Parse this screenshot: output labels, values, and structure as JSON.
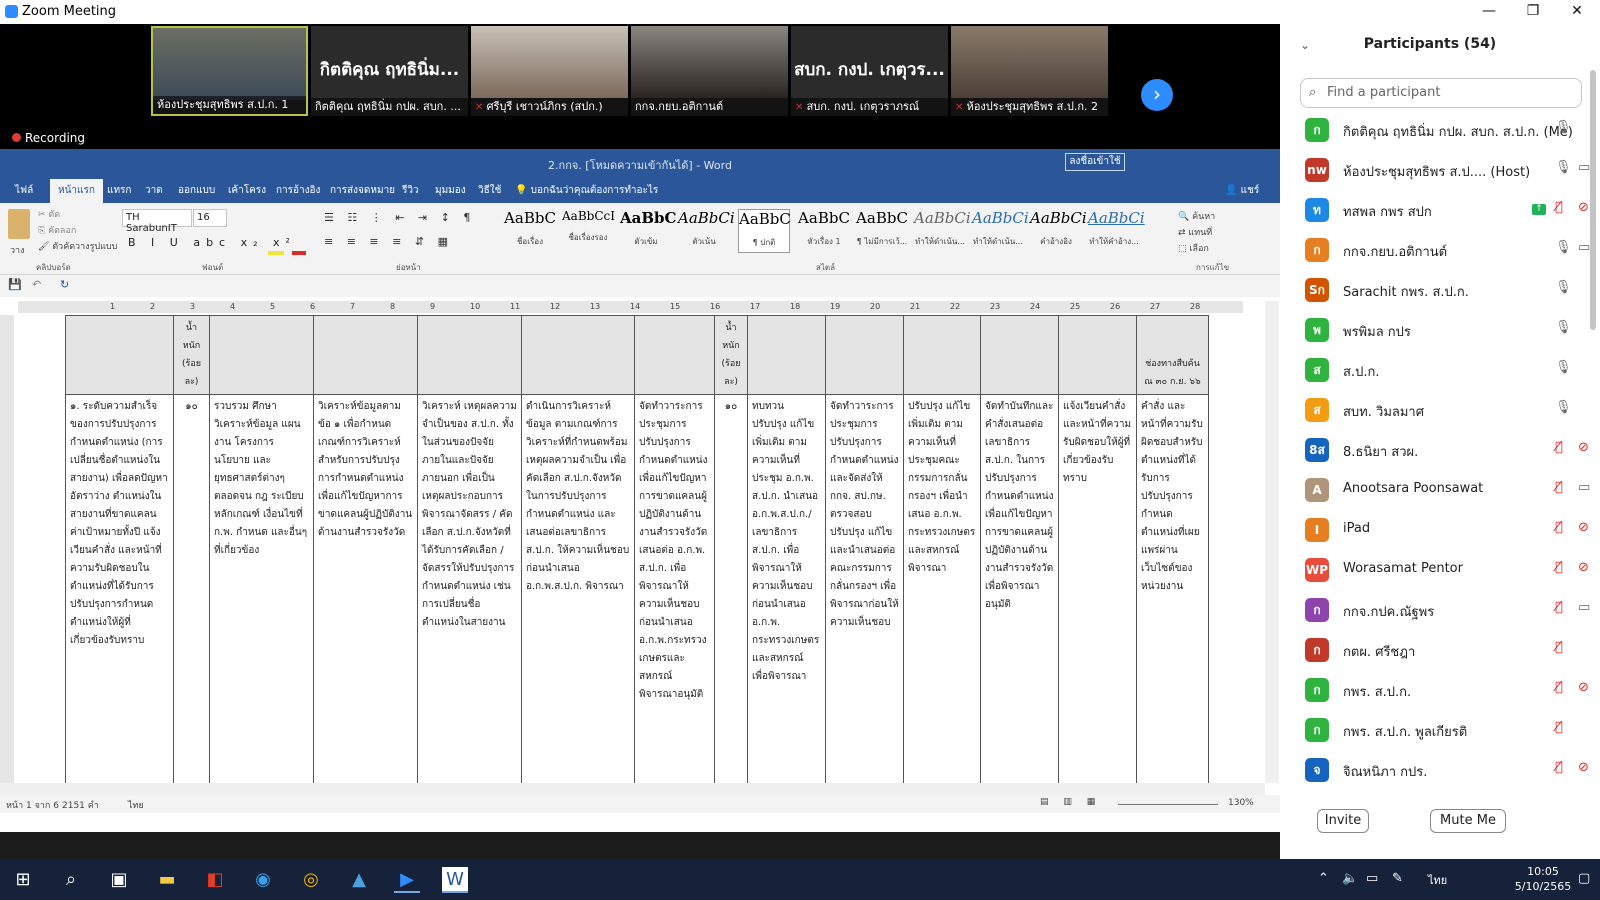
{
  "window": {
    "title": "Zoom Meeting",
    "min": "—",
    "max": "❐",
    "close": "✕"
  },
  "gallery": {
    "tiles": [
      {
        "caption": "ห้องประชุมสุทธิพร ส.ป.ก. 1",
        "big": ""
      },
      {
        "caption": "กิตติคุณ ฤทธินิ่ม กปผ. สบก. ...",
        "big": "กิตติคุณ ฤทธินิ่ม..."
      },
      {
        "caption": "ศรีบุรี เชาวน์ภิกร (สปก.)",
        "big": ""
      },
      {
        "caption": "กกจ.กยบ.อติกานต์",
        "big": ""
      },
      {
        "caption": "สบก. กงป. เกตุวราภรณ์",
        "big": "สบก. กงป. เกตุวร..."
      },
      {
        "caption": "ห้องประชุมสุทธิพร ส.ป.ก. 2",
        "big": ""
      }
    ],
    "next_icon": "›",
    "recording": "Recording"
  },
  "word": {
    "title": "2.กกจ. [โหมดความเข้ากันได้] - Word",
    "signin": "ลงชื่อเข้าใช้",
    "tabs": [
      "ไฟล์",
      "หน้าแรก",
      "แทรก",
      "วาด",
      "ออกแบบ",
      "เค้าโครง",
      "การอ้างอิง",
      "การส่งจดหมาย",
      "รีวิว",
      "มุมมอง",
      "วิธีใช้",
      "บอกฉันว่าคุณต้องการทำอะไร"
    ],
    "share": "แชร์",
    "font": "TH SarabunIT",
    "size": "16",
    "clipboard": {
      "cut": "ตัด",
      "copy": "คัดลอก",
      "painter": "ตัวคัดวางรูปแบบ",
      "paste": "วาง"
    },
    "groups": {
      "clipboard": "คลิปบอร์ด",
      "font": "ฟอนต์",
      "paragraph": "ย่อหน้า",
      "styles": "สไตล์",
      "editing": "การแก้ไข"
    },
    "styles": [
      {
        "s": "AaBbC",
        "n": "ชื่อเรื่อง"
      },
      {
        "s": "AaBbCcI",
        "n": "ชื่อเรื่องรอง"
      },
      {
        "s": "AaBbC",
        "n": "ตัวเข้ม"
      },
      {
        "s": "AaBbCi",
        "n": "ตัวเน้น"
      },
      {
        "s": "AaBbC",
        "n": "¶ ปกติ"
      },
      {
        "s": "AaBbC",
        "n": "หัวเรื่อง 1"
      },
      {
        "s": "AaBbC",
        "n": "¶ ไม่มีการเว้..."
      },
      {
        "s": "AaBbCi",
        "n": "ทำให้ดำเน้น..."
      },
      {
        "s": "AaBbCi",
        "n": "ทำให้ดำเน้น..."
      },
      {
        "s": "AaBbCi",
        "n": "คำอ้างอิง"
      },
      {
        "s": "AaBbCi",
        "n": "ทำให้คำอ้าง..."
      }
    ],
    "editing": {
      "find": "ค้นหา",
      "replace": "แทนที่",
      "select": "เลือก"
    },
    "ruler": [
      "1",
      "2",
      "3",
      "4",
      "5",
      "6",
      "7",
      "8",
      "9",
      "10",
      "11",
      "12",
      "13",
      "14",
      "15",
      "16",
      "17",
      "18",
      "19",
      "20",
      "21",
      "22",
      "23",
      "24",
      "25",
      "26",
      "27",
      "28"
    ],
    "status": {
      "page": "หน้า 1 จาก 6",
      "words": "2151 คำ",
      "lang": "ไทย",
      "zoom": "130%"
    },
    "header_cells": [
      "",
      "น้ำหนัก (ร้อยละ)",
      "",
      "",
      "",
      "",
      "",
      "น้ำหนัก (ร้อยละ)",
      "",
      "",
      "",
      "",
      "",
      "ช่องทางสืบค้น ณ ๓๐ ก.ย. ๖๖"
    ],
    "body_cells": [
      "๑. ระดับความสำเร็จของการปรับปรุงการกำหนดตำแหน่ง (การเปลี่ยนชื่อตำแหน่งในสายงาน) เพื่อลดปัญหาอัตราว่าง ตำแหน่งในสายงานที่ขาดแคลน ค่าเป้าหมายทั้งปี แจ้งเวียนคำสั่ง และหน้าที่ความรับผิดชอบในตำแหน่งที่ได้รับการปรับปรุงการกำหนดตำแหน่งให้ผู้ที่เกี่ยวข้องรับทราบ",
      "๑๐",
      "รวบรวม ศึกษา วิเคราะห์ข้อมูล แผนงาน โครงการ นโยบาย และยุทธศาสตร์ต่างๆ ตลอดจน กฎ ระเบียบ หลักเกณฑ์ เงื่อนไขที่ ก.พ. กำหนด และอื่นๆ ที่เกี่ยวข้อง",
      "วิเคราะห์ข้อมูลตามข้อ ๑ เพื่อกำหนดเกณฑ์การวิเคราะห์สำหรับการปรับปรุงการกำหนดตำแหน่งเพื่อแก้ไขปัญหาการขาดแคลนผู้ปฏิบัติงานด้านงานสำรวจรังวัด",
      "วิเคราะห์ เหตุผลความจำเป็นของ ส.ป.ก. ทั้งในส่วนของปัจจัยภายในและปัจจัยภายนอก เพื่อเป็นเหตุผลประกอบการพิจารณาจัดสรร / คัดเลือก ส.ป.ก.จังหวัดที่ได้รับการคัดเลือก /จัดสรรให้ปรับปรุงการกำหนดตำแหน่ง เช่น การเปลี่ยนชื่อตำแหน่งในสายงาน",
      "ดำเนินการวิเคราะห์ข้อมูล ตามเกณฑ์การวิเคราะห์ที่กำหนดพร้อมเหตุผลความจำเป็น เพื่อคัดเลือก ส.ป.ก.จังหวัด ในการปรับปรุงการกำหนดตำแหน่ง และเสนอต่อเลขาธิการ ส.ป.ก. ให้ความเห็นชอบ ก่อนนำเสนอ อ.ก.พ.ส.ป.ก. พิจารณา",
      "จัดทำวาระการประชุมการปรับปรุงการกำหนดตำแหน่งเพื่อแก้ไขปัญหาการขาดแคลนผู้ปฏิบัติงานด้านงานสำรวจรังวัด เสนอต่อ อ.ก.พ. ส.ป.ก. เพื่อพิจารณาให้ความเห็นชอบก่อนนำเสนอ อ.ก.พ.กระทรวงเกษตรและสหกรณ์ พิจารณาอนุมัติ",
      "๑๐",
      "ทบทวน ปรับปรุง แก้ไขเพิ่มเติม ตามความเห็นที่ประชุม อ.ก.พ. ส.ป.ก. นำเสนอ อ.ก.พ.ส.ป.ก./เลขาธิการ ส.ป.ก. เพื่อพิจารณาให้ความเห็นชอบก่อนนำเสนอ อ.ก.พ. กระทรวงเกษตรและสหกรณ์ เพื่อพิจารณา",
      "จัดทำวาระการประชุมการปรับปรุงการกำหนดตำแหน่ง และจัดส่งให้ กกจ. สป.กษ. ตรวจสอบ ปรับปรุง แก้ไขและนำเสนอต่อคณะกรรมการกลั่นกรองฯ เพื่อพิจารณาก่อนให้ความเห็นชอบ",
      "ปรับปรุง แก้ไขเพิ่มเติม ตามความเห็นที่ประชุมคณะกรรมการกลั่นกรองฯ เพื่อนำเสนอ อ.ก.พ. กระทรวงเกษตรและสหกรณ์ พิจารณา",
      "จัดทำบันทึกและคำสั่งเสนอต่อเลขาธิการ ส.ป.ก. ในการปรับปรุงการกำหนดตำแหน่ง เพื่อแก้ไขปัญหาการขาดแคลนผู้ปฏิบัติงานด้านงานสำรวจรังวัด เพื่อพิจารณาอนุมัติ",
      "แจ้งเวียนคำสั่งและหน้าที่ความรับผิดชอบให้ผู้ที่เกี่ยวข้องรับทราบ",
      "คำสั่ง และหน้าที่ความรับผิดชอบสำหรับตำแหน่งที่ได้รับการปรับปรุงการกำหนดตำแหน่งที่เผยแพร่ผ่านเว็บไซต์ของหน่วยงาน"
    ]
  },
  "participants": {
    "title": "Participants (54)",
    "search_placeholder": "Find a participant",
    "list": [
      {
        "initial": "ก",
        "color": "#2eb33e",
        "name": "กิตติคุณ ฤทธินิ่ม กปผ. สบก. ส.ป.ก. (Me)",
        "mic": "on",
        "cam": "none"
      },
      {
        "initial": "nw",
        "color": "#c0392b",
        "name": "ห้องประชุมสุทธิพร ส.ป.... (Host)",
        "mic": "on",
        "cam": "on"
      },
      {
        "initial": "ท",
        "color": "#1e88e5",
        "name": "ทสพล กพร สปก",
        "mic": "off",
        "cam": "off"
      },
      {
        "initial": "ก",
        "color": "#e67e22",
        "name": "กกจ.กยบ.อติกานต์",
        "mic": "on",
        "cam": "on"
      },
      {
        "initial": "Sก",
        "color": "#d35400",
        "name": "Sarachit กพร. ส.ป.ก.",
        "mic": "on",
        "cam": "none"
      },
      {
        "initial": "พ",
        "color": "#2eb33e",
        "name": "พรพิมล กปร",
        "mic": "on",
        "cam": "none"
      },
      {
        "initial": "ส",
        "color": "#2eb33e",
        "name": "ส.ป.ก.",
        "mic": "on",
        "cam": "none"
      },
      {
        "initial": "ส",
        "color": "#f39c12",
        "name": "สบท. วิมลมาศ",
        "mic": "on",
        "cam": "none"
      },
      {
        "initial": "8ส",
        "color": "#1565c0",
        "name": "8.ธนิยา สวผ.",
        "mic": "off",
        "cam": "off"
      },
      {
        "initial": "A",
        "color": "#b0957a",
        "name": "Anootsara Poonsawat",
        "mic": "off",
        "cam": "on"
      },
      {
        "initial": "I",
        "color": "#e67e22",
        "name": "iPad",
        "mic": "off",
        "cam": "off"
      },
      {
        "initial": "WP",
        "color": "#e74c3c",
        "name": "Worasamat Pentor",
        "mic": "off",
        "cam": "off"
      },
      {
        "initial": "ก",
        "color": "#8e44ad",
        "name": "กกจ.กปค.ณัฐพร",
        "mic": "off",
        "cam": "on"
      },
      {
        "initial": "ก",
        "color": "#c0392b",
        "name": "กตผ. ศรีชฎา",
        "mic": "off",
        "cam": "none"
      },
      {
        "initial": "ก",
        "color": "#2eb33e",
        "name": "กพร. ส.ป.ก.",
        "mic": "off",
        "cam": "off"
      },
      {
        "initial": "ก",
        "color": "#2eb33e",
        "name": "กพร. ส.ป.ก. พูลเกียรติ",
        "mic": "off",
        "cam": "none"
      },
      {
        "initial": "จ",
        "color": "#1565c0",
        "name": "จิณหนิภา กปร.",
        "mic": "off",
        "cam": "off"
      }
    ],
    "invite": "Invite",
    "mute_me": "Mute Me"
  },
  "taskbar": {
    "time": "10:05",
    "date": "5/10/2565",
    "lang": "ไทย"
  }
}
